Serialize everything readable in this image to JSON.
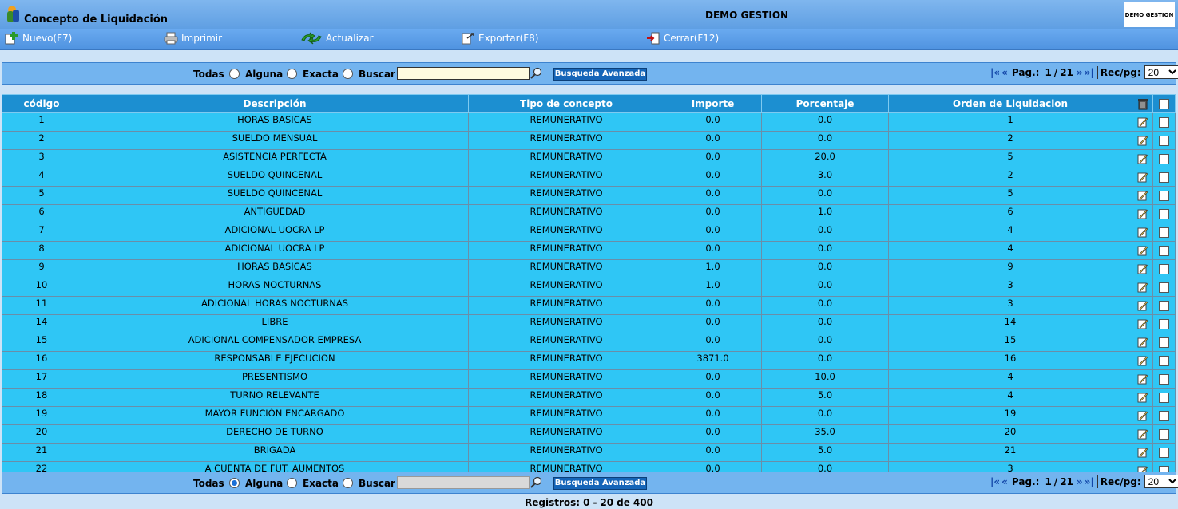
{
  "header": {
    "title": "Concepto de Liquidación",
    "company": "DEMO GESTION",
    "logo_text": "DEMO GESTION"
  },
  "toolbar": {
    "new_label": "Nuevo(F7)",
    "print_label": "Imprimir",
    "refresh_label": "Actualizar",
    "export_label": "Exportar(F8)",
    "close_label": "Cerrar(F12)"
  },
  "filter": {
    "todas": "Todas",
    "alguna": "Alguna",
    "exacta": "Exacta",
    "buscar": "Buscar",
    "search_value": "",
    "advanced_label": "Busqueda Avanzada",
    "selected_top": "none",
    "selected_bottom": "Todas"
  },
  "pager": {
    "first": "|«",
    "prev": "«",
    "label": "Pag.:",
    "current": "1",
    "separator": "/",
    "total": "21",
    "next": "»",
    "last": "»|",
    "rec_label": "Rec/pg:",
    "rec_value": "20"
  },
  "table": {
    "headers": [
      "código",
      "Descripción",
      "Tipo de concepto",
      "Importe",
      "Porcentaje",
      "Orden de Liquidacion"
    ],
    "rows": [
      [
        "1",
        "HORAS BASICAS",
        "REMUNERATIVO",
        "0.0",
        "0.0",
        "1"
      ],
      [
        "2",
        "SUELDO MENSUAL",
        "REMUNERATIVO",
        "0.0",
        "0.0",
        "2"
      ],
      [
        "3",
        "ASISTENCIA PERFECTA",
        "REMUNERATIVO",
        "0.0",
        "20.0",
        "5"
      ],
      [
        "4",
        "SUELDO QUINCENAL",
        "REMUNERATIVO",
        "0.0",
        "3.0",
        "2"
      ],
      [
        "5",
        "SUELDO QUINCENAL",
        "REMUNERATIVO",
        "0.0",
        "0.0",
        "5"
      ],
      [
        "6",
        "ANTIGUEDAD",
        "REMUNERATIVO",
        "0.0",
        "1.0",
        "6"
      ],
      [
        "7",
        "ADICIONAL UOCRA LP",
        "REMUNERATIVO",
        "0.0",
        "0.0",
        "4"
      ],
      [
        "8",
        "ADICIONAL UOCRA LP",
        "REMUNERATIVO",
        "0.0",
        "0.0",
        "4"
      ],
      [
        "9",
        "HORAS BASICAS",
        "REMUNERATIVO",
        "1.0",
        "0.0",
        "9"
      ],
      [
        "10",
        "HORAS NOCTURNAS",
        "REMUNERATIVO",
        "1.0",
        "0.0",
        "3"
      ],
      [
        "11",
        "ADICIONAL HORAS NOCTURNAS",
        "REMUNERATIVO",
        "0.0",
        "0.0",
        "3"
      ],
      [
        "14",
        "LIBRE",
        "REMUNERATIVO",
        "0.0",
        "0.0",
        "14"
      ],
      [
        "15",
        "ADICIONAL COMPENSADOR EMPRESA",
        "REMUNERATIVO",
        "0.0",
        "0.0",
        "15"
      ],
      [
        "16",
        "RESPONSABLE EJECUCION",
        "REMUNERATIVO",
        "3871.0",
        "0.0",
        "16"
      ],
      [
        "17",
        "PRESENTISMO",
        "REMUNERATIVO",
        "0.0",
        "10.0",
        "4"
      ],
      [
        "18",
        "TURNO RELEVANTE",
        "REMUNERATIVO",
        "0.0",
        "5.0",
        "4"
      ],
      [
        "19",
        "MAYOR FUNCIÓN ENCARGADO",
        "REMUNERATIVO",
        "0.0",
        "0.0",
        "19"
      ],
      [
        "20",
        "DERECHO DE TURNO",
        "REMUNERATIVO",
        "0.0",
        "35.0",
        "20"
      ],
      [
        "21",
        "BRIGADA",
        "REMUNERATIVO",
        "0.0",
        "5.0",
        "21"
      ],
      [
        "22",
        "A CUENTA DE FUT. AUMENTOS",
        "REMUNERATIVO",
        "0.0",
        "0.0",
        "3"
      ]
    ]
  },
  "status": {
    "label": "Registros:",
    "from": "0",
    "dash": "-",
    "to": "20",
    "of": "de",
    "total": "400"
  },
  "icons": {
    "app": "app-logo-icon",
    "new": "new-icon",
    "print": "printer-icon",
    "refresh": "refresh-icon",
    "export": "export-icon",
    "close": "exit-icon",
    "search": "magnifier-icon",
    "delete": "trash-icon",
    "edit": "edit-icon"
  },
  "colors": {
    "header": "#6aaaf0",
    "table_header": "#1c8fd1",
    "table_row": "#2fc6f5",
    "button": "#1565b8",
    "page_bg": "#cde3f7"
  }
}
